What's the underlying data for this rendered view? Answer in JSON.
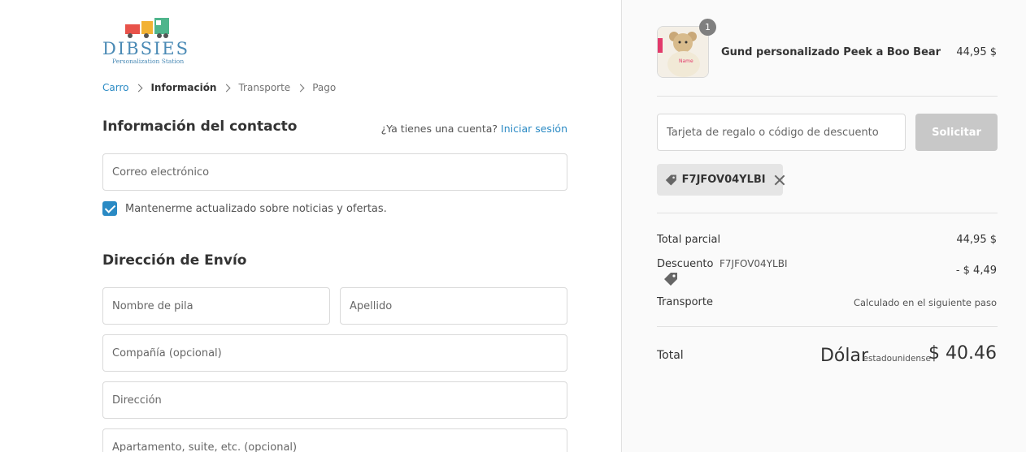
{
  "logo": {
    "name": "DIBSIES",
    "tagline": "Personalization Station"
  },
  "breadcrumb": [
    "Carro",
    "Información",
    "Transporte",
    "Pago"
  ],
  "contact": {
    "title": "Información del contacto",
    "have_account": "¿Ya tienes una cuenta?",
    "login_link": "Iniciar sesión",
    "email_placeholder": "Correo electrónico",
    "newsletter_label": "Mantenerme actualizado sobre noticias y ofertas."
  },
  "shipping": {
    "title": "Dirección de Envío",
    "first_name_placeholder": "Nombre de pila",
    "last_name_placeholder": "Apellido",
    "company_placeholder": "Compañía (opcional)",
    "address_placeholder": "Dirección",
    "apartment_placeholder": "Apartamento, suite, etc. (opcional)"
  },
  "cart": {
    "quantity": "1",
    "product_name": "Gund personalizado Peek a Boo Bear",
    "product_price": "44,95 $",
    "discount_placeholder": "Tarjeta de regalo o código de descuento",
    "apply_label": "Solicitar",
    "applied_code": "F7JFOV04YLBI"
  },
  "summary": {
    "subtotal_label": "Total parcial",
    "subtotal_value": "44,95 $",
    "discount_label": "Descuento",
    "discount_code": "F7JFOV04YLBI",
    "discount_value": "- $ 4,49",
    "shipping_label": "Transporte",
    "shipping_value": "Calculado en el siguiente paso",
    "total_label": "Total",
    "total_currency_word": "Dólar",
    "total_currency_sub": "estadounidense",
    "total_value": "$ 40.46"
  },
  "colors": {
    "accent": "#2a8ac4",
    "button_disabled": "#c8c8c8",
    "sidebar_bg": "#fafafa"
  }
}
